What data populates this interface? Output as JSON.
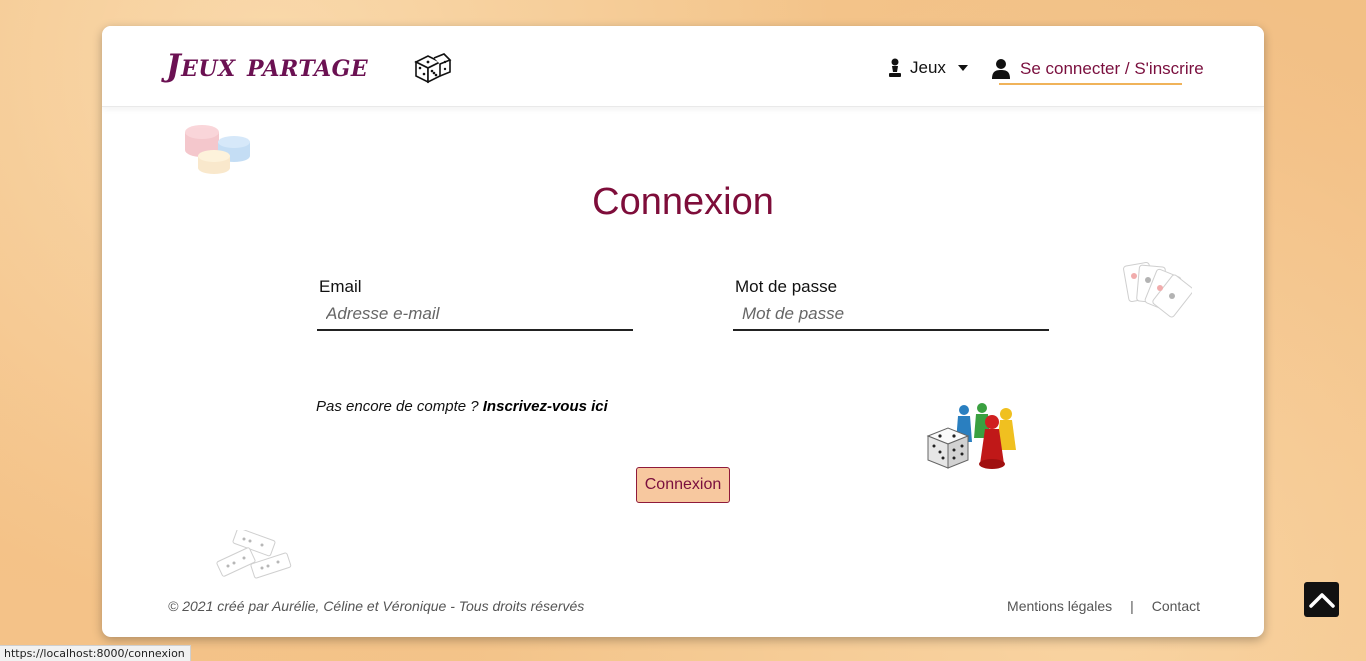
{
  "header": {
    "brand": "Jeux partage",
    "nav_games_label": "Jeux",
    "nav_login_label": "Se connecter / S'inscrire"
  },
  "main": {
    "title": "Connexion",
    "email_label": "Email",
    "email_placeholder": "Adresse e-mail",
    "password_label": "Mot de passe",
    "password_placeholder": "Mot de passe",
    "signup_prompt": "Pas encore de compte ? ",
    "signup_link": "Inscrivez-vous ici",
    "submit_label": "Connexion"
  },
  "footer": {
    "copyright": "© 2021 créé par Aurélie, Céline et Véronique - Tous droits réservés",
    "legal_link": "Mentions légales",
    "separator": "|",
    "contact_link": "Contact"
  },
  "status_bar": {
    "url": "https://localhost:8000/connexion"
  },
  "colors": {
    "brand": "#6b1152",
    "accent": "#7e0d3a",
    "button_bg": "#f7c89f",
    "underline": "#f0b35a",
    "background": "#f3c48a"
  },
  "icons": [
    "dice-icon",
    "pawn-icon",
    "user-icon",
    "chevron-down-icon",
    "poker-chips-icon",
    "playing-cards-icon",
    "board-game-pieces-icon",
    "dominoes-icon",
    "chevron-up-icon"
  ]
}
